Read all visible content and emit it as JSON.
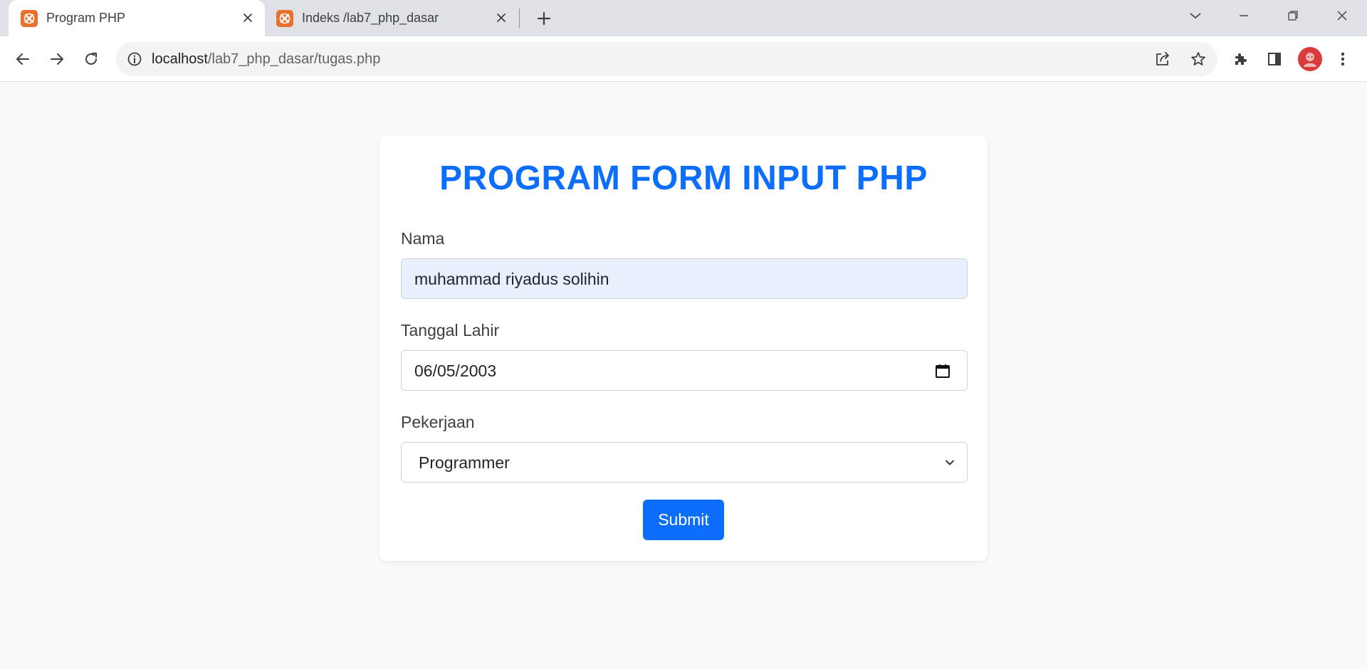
{
  "browser": {
    "tabs": [
      {
        "title": "Program PHP",
        "active": true,
        "favicon": "xampp-icon"
      },
      {
        "title": "Indeks /lab7_php_dasar",
        "active": false,
        "favicon": "xampp-icon"
      }
    ],
    "url_host": "localhost",
    "url_path": "/lab7_php_dasar/tugas.php",
    "accent_favicon_color": "#e8702a"
  },
  "form": {
    "title": "PROGRAM FORM INPUT PHP",
    "nama_label": "Nama",
    "nama_value": "muhammad riyadus solihin",
    "tanggal_label": "Tanggal Lahir",
    "tanggal_value": "06/05/2003",
    "pekerjaan_label": "Pekerjaan",
    "pekerjaan_value": "Programmer",
    "submit_label": "Submit",
    "accent_color": "#0d6efd"
  }
}
